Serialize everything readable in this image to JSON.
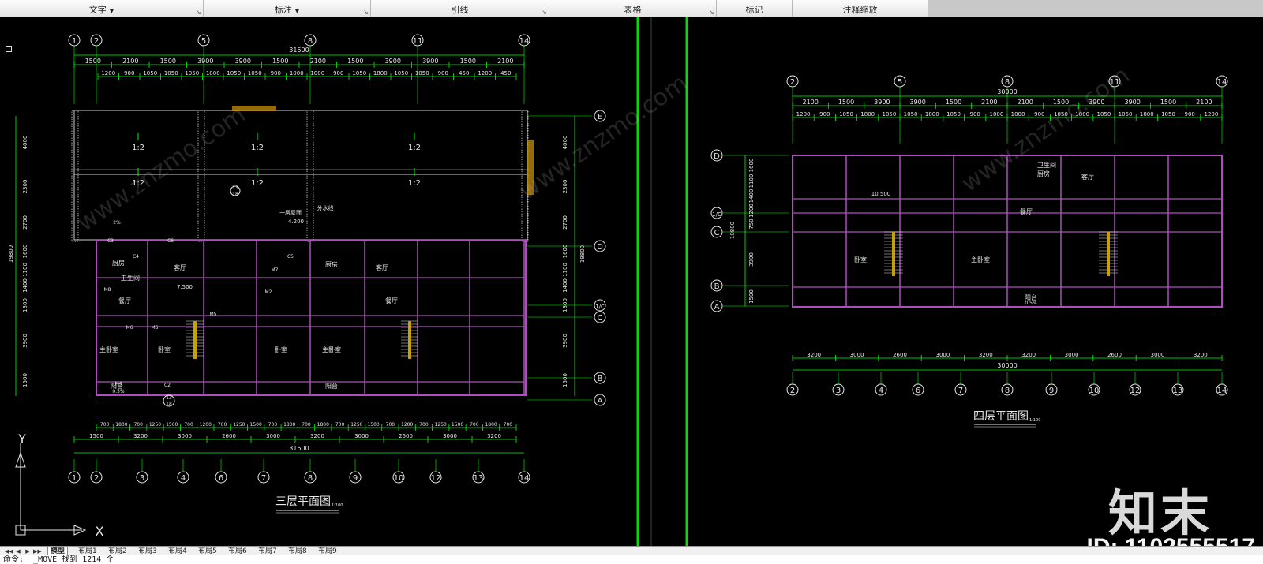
{
  "ribbon": {
    "panels": [
      {
        "label": "文字",
        "has_dropdown": true
      },
      {
        "label": "标注",
        "has_dropdown": true
      },
      {
        "label": "引线",
        "has_dropdown": false
      },
      {
        "label": "表格",
        "has_dropdown": false
      },
      {
        "label": "标记",
        "has_dropdown": false
      },
      {
        "label": "注释缩放",
        "has_dropdown": false
      }
    ],
    "dropdown_glyph": "▼",
    "expand_glyph": "↘"
  },
  "drawing": {
    "background": "#000000",
    "line_color": "#00ff00",
    "wall_color": "#b04cc0",
    "separator_color": "#00e000",
    "left_plan": {
      "title": "三层平面图",
      "scale": "1:100",
      "top_axes": [
        "1",
        "2",
        "5",
        "8",
        "11",
        "14"
      ],
      "bottom_axes": [
        "1",
        "2",
        "3",
        "4",
        "6",
        "7",
        "8",
        "9",
        "10",
        "12",
        "13",
        "14"
      ],
      "right_axes": [
        "E",
        "D",
        "1/C",
        "C",
        "B",
        "A"
      ],
      "overall_dim": "31500",
      "top_dims": [
        "1500",
        "2100",
        "1500",
        "3900",
        "3900",
        "1500",
        "2100",
        "1500",
        "3900",
        "3900",
        "1500",
        "2100"
      ],
      "detail_dims": [
        "1200",
        "900",
        "1050",
        "1050",
        "1050",
        "1800",
        "1050",
        "1050",
        "900",
        "1000",
        "1000",
        "900",
        "1050",
        "1800",
        "1050",
        "1050",
        "900",
        "450",
        "1200",
        "450"
      ],
      "bottom_dims": [
        "1500",
        "3200",
        "3000",
        "2600",
        "3000",
        "3200",
        "3000",
        "2600",
        "3000",
        "3200"
      ],
      "bottom_detail_dims": [
        "700",
        "1800",
        "700",
        "1250",
        "1500",
        "700",
        "1200",
        "700",
        "1250",
        "1500",
        "700",
        "1800",
        "700",
        "1800",
        "700",
        "1250",
        "1500",
        "700",
        "1200",
        "700",
        "1250",
        "1500",
        "700",
        "1800",
        "700"
      ],
      "vertical_dims": [
        "4000",
        "2300",
        "2700",
        "1600",
        "1100",
        "1400",
        "1300",
        "3900",
        "1500"
      ],
      "vertical_total": "19800",
      "roof_labels": [
        "1:2",
        "1:2",
        "1:2",
        "1:2",
        "1:2",
        "1:2"
      ],
      "rooms": [
        "客厅",
        "餐厅",
        "主卧室",
        "卧室",
        "厨房",
        "卫生间",
        "阳台",
        "客厅",
        "餐厅",
        "主卧室",
        "卧室",
        "厨房",
        "阳台"
      ],
      "door_tags": [
        "M6",
        "M6",
        "M8",
        "M4",
        "M5",
        "M7",
        "M2"
      ],
      "window_tags": [
        "C3",
        "C4",
        "C5",
        "C6",
        "C2"
      ],
      "annotations": [
        "一层屋面",
        "4.200",
        "分水线",
        "2%",
        "7.500",
        "0.5%",
        "13",
        "18"
      ]
    },
    "right_plan": {
      "title": "四层平面图",
      "scale": "1:100",
      "top_axes": [
        "2",
        "5",
        "8",
        "11",
        "14"
      ],
      "bottom_axes": [
        "2",
        "3",
        "4",
        "6",
        "7",
        "8",
        "9",
        "10",
        "12",
        "13",
        "14"
      ],
      "left_axes": [
        "D",
        "1/C",
        "C",
        "B",
        "A"
      ],
      "overall_dim": "30000",
      "top_dims": [
        "2100",
        "1500",
        "3900",
        "3900",
        "1500",
        "2100",
        "2100",
        "1500",
        "3900",
        "3900",
        "1500",
        "2100"
      ],
      "detail_dims": [
        "1200",
        "900",
        "1050",
        "1800",
        "1050",
        "1050",
        "1800",
        "1050",
        "900",
        "1000",
        "1000",
        "900",
        "1050",
        "1800",
        "1050",
        "1050",
        "1800",
        "1050",
        "900",
        "1200"
      ],
      "bottom_dims": [
        "3200",
        "3000",
        "2600",
        "3000",
        "3200",
        "3200",
        "3000",
        "2600",
        "3000",
        "3200"
      ],
      "vertical_dims": [
        "1600",
        "1100",
        "1400",
        "1200",
        "750",
        "3900",
        "1500"
      ],
      "vertical_total": "10800",
      "rooms": [
        "客厅",
        "餐厅",
        "主卧室",
        "卧室",
        "厨房",
        "卫生间",
        "阳台"
      ],
      "annotations": [
        "10.500",
        "0.5%"
      ]
    }
  },
  "ucs": {
    "x_label": "X",
    "y_label": "Y"
  },
  "layout_tabs": {
    "nav": [
      "◀◀",
      "◀",
      "▶",
      "▶▶"
    ],
    "items": [
      "模型",
      "布局1",
      "布局2",
      "布局3",
      "布局4",
      "布局5",
      "布局6",
      "布局7",
      "布局8",
      "布局9"
    ],
    "active": "模型"
  },
  "command_line": {
    "text": "命令:  _MOVE 找到 1214 个"
  },
  "watermark": {
    "brand": "知末",
    "id_text": "ID: 1102555517",
    "diagonal_text": "www.znzmo.com"
  }
}
